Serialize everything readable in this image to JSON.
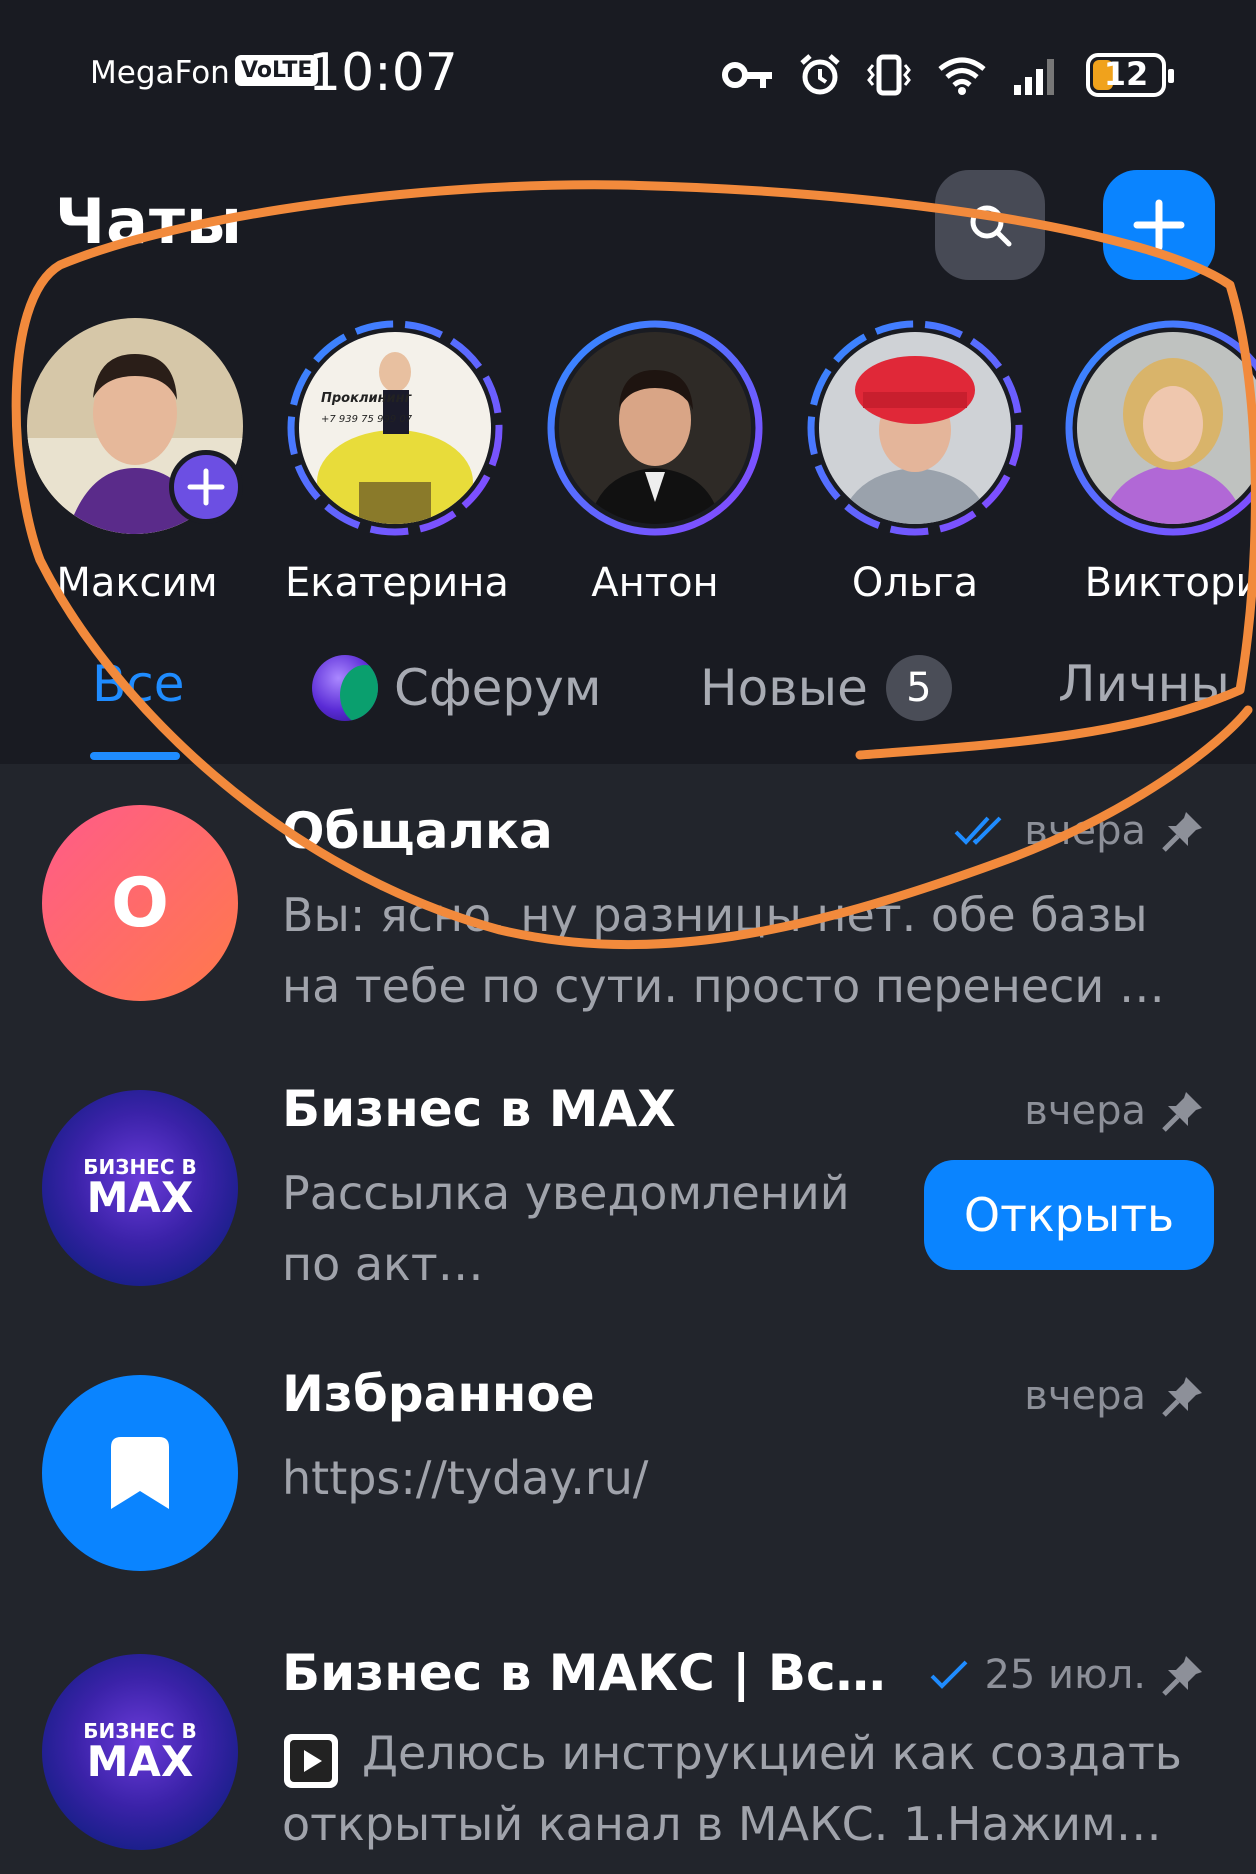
{
  "status_bar": {
    "carrier": "MegaFon",
    "network": "VoLTE",
    "time": "10:07",
    "battery": "12",
    "icons": [
      "key-icon",
      "alarm-icon",
      "vibrate-icon",
      "wifi-icon",
      "signal-icon",
      "battery-icon"
    ]
  },
  "header": {
    "title": "Чаты"
  },
  "stories": [
    {
      "name": "Максим"
    },
    {
      "name": "Екатерина",
      "photo_text_1": "Проклининг",
      "photo_text_2": "+7 939 75 999 07"
    },
    {
      "name": "Антон"
    },
    {
      "name": "Ольга"
    },
    {
      "name": "Виктори"
    }
  ],
  "tabs": [
    {
      "label": "Все",
      "active": true
    },
    {
      "label": "Сферум"
    },
    {
      "label": "Новые",
      "badge": "5"
    },
    {
      "label": "Личны"
    }
  ],
  "chats": [
    {
      "avatar_letter": "О",
      "name": "Общалка",
      "time": "вчера",
      "message": "Вы: ясно. ну разницы нет. обе базы на тебе по сути. просто перенеси …",
      "status": "read-double-check",
      "pinned": true
    },
    {
      "avatar_small": "БИЗНЕС В",
      "avatar_big": "MAX",
      "name": "Бизнес в MAX",
      "time": "вчера",
      "message": "Рассылка уведомлений по акт…",
      "button": "Открыть",
      "pinned": true
    },
    {
      "name": "Избранное",
      "time": "вчера",
      "message": "https://tyday.ru/",
      "pinned": true
    },
    {
      "avatar_small": "БИЗНЕС В",
      "avatar_big": "MAX",
      "name": "Бизнес в МАКС | Вс…",
      "time": "25 июл.",
      "message": "Делюсь инструкцией как создать открытый канал в МАКС. 1.Нажим…",
      "status": "sent-single-check",
      "pinned": true
    }
  ],
  "colors": {
    "accent": "#0a84ff",
    "background_top": "#191b22",
    "background_list": "#22252c",
    "annotation": "#f28a3c",
    "muted_text": "#a0a3ab"
  }
}
